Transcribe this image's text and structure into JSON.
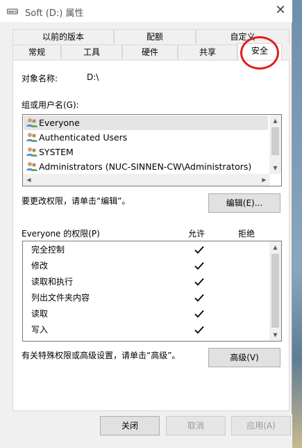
{
  "window": {
    "title": "Soft (D:) 属性",
    "close_glyph": "✕"
  },
  "tabs_back": [
    "以前的版本",
    "配额",
    "自定义"
  ],
  "tabs_front": [
    "常规",
    "工具",
    "硬件",
    "共享",
    "安全"
  ],
  "object": {
    "label": "对象名称:",
    "value": "D:\\"
  },
  "groups": {
    "label": "组或用户名(G):",
    "items": [
      "Everyone",
      "Authenticated Users",
      "SYSTEM",
      "Administrators (NUC-SINNEN-CW\\Administrators)"
    ]
  },
  "change_hint": "要更改权限，请单击“编辑”。",
  "edit_button": "编辑(E)...",
  "perms": {
    "header": "Everyone 的权限(P)",
    "allow_header": "允许",
    "deny_header": "拒绝",
    "rows": [
      {
        "name": "完全控制",
        "allow": true
      },
      {
        "name": "修改",
        "allow": true
      },
      {
        "name": "读取和执行",
        "allow": true
      },
      {
        "name": "列出文件夹内容",
        "allow": true
      },
      {
        "name": "读取",
        "allow": true
      },
      {
        "name": "写入",
        "allow": true
      }
    ]
  },
  "advanced_hint": "有关特殊权限或高级设置，请单击“高级”。",
  "advanced_button": "高级(V)",
  "footer": {
    "close": "关闭",
    "cancel": "取消",
    "apply": "应用(A)"
  },
  "colors": {
    "highlight_circle": "#e21d1d",
    "selected_row": "#e5e5e5"
  }
}
